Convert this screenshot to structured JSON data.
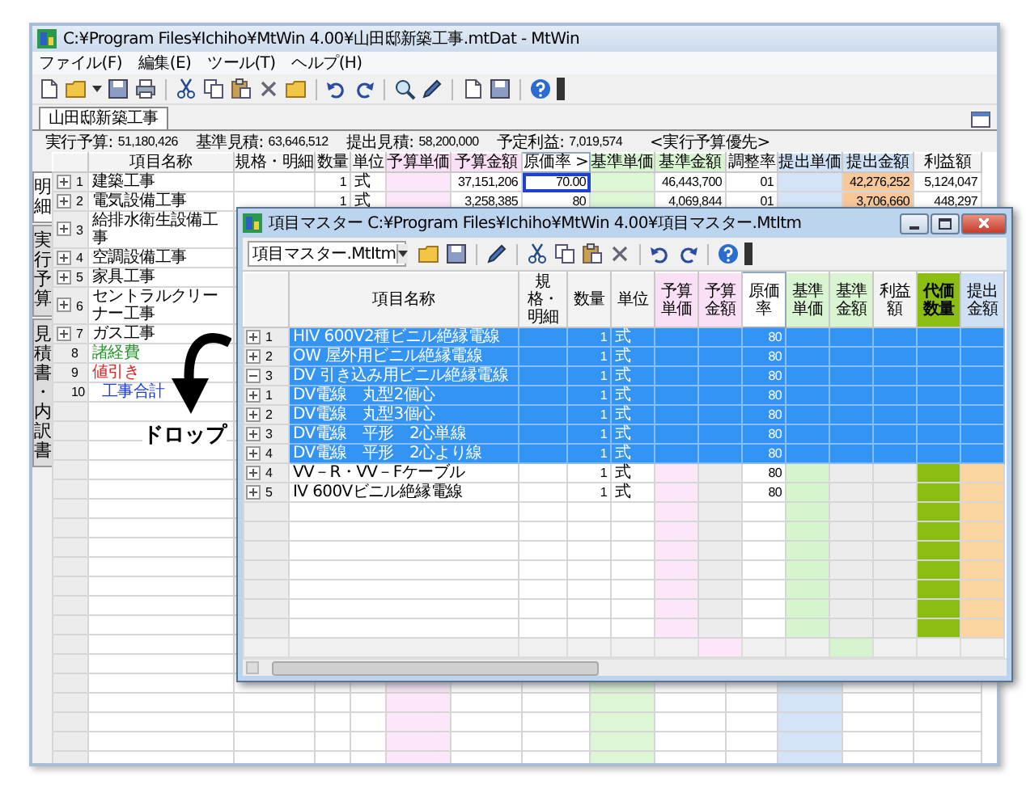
{
  "window": {
    "title": "C:¥Program Files¥Ichiho¥MtWin 4.00¥山田邸新築工事.mtDat - MtWin"
  },
  "menu": [
    "ファイル(F)",
    "編集(E)",
    "ツール(T)",
    "ヘルプ(H)"
  ],
  "tabs": [
    {
      "label": "山田邸新築工事",
      "selected": true
    }
  ],
  "summary": [
    {
      "label": "実行予算:",
      "value": "51,180,426"
    },
    {
      "label": "基準見積:",
      "value": "63,646,512"
    },
    {
      "label": "提出見積:",
      "value": "58,200,000"
    },
    {
      "label": "予定利益:",
      "value": "7,019,574"
    }
  ],
  "summary_note": "<実行予算優先>",
  "side_tabs": [
    {
      "label": "明細",
      "selected": true
    },
    {
      "label": "実行予算",
      "selected": false
    },
    {
      "label": "見積書・内訳書",
      "selected": false
    }
  ],
  "grid": {
    "columns": [
      {
        "label": "項目名称",
        "kind": "text"
      },
      {
        "label": "規格・明細",
        "kind": "text"
      },
      {
        "label": "数量",
        "kind": "qty"
      },
      {
        "label": "単位",
        "kind": "unit"
      },
      {
        "label": "予算単価",
        "kind": "budget-unit"
      },
      {
        "label": "予算金額",
        "kind": "budget-total"
      },
      {
        "label": "原価率 >",
        "kind": "rate"
      },
      {
        "label": "基準単価",
        "kind": "std-unit"
      },
      {
        "label": "基準金額",
        "kind": "std-total"
      },
      {
        "label": "調整率",
        "kind": "adjust"
      },
      {
        "label": "提出単価",
        "kind": "submit-unit"
      },
      {
        "label": "提出金額",
        "kind": "submit-total"
      },
      {
        "label": "利益額",
        "kind": "profit"
      }
    ],
    "rows": [
      {
        "no": "1",
        "name": "建築工事",
        "kind": "item",
        "expanded": false,
        "quantity": "1",
        "unit": "式",
        "budget_amount": "37,151,206",
        "cost_rate": "70.00",
        "editing": true,
        "std_amount": "46,443,700",
        "adjust": "01",
        "submit_amount": "42,276,252",
        "profit": "5,124,047"
      },
      {
        "no": "2",
        "name": "電気設備工事",
        "kind": "item",
        "expanded": false,
        "quantity": "1",
        "unit": "式",
        "budget_amount": "3,258,385",
        "cost_rate": "80",
        "std_amount": "4,069,844",
        "adjust": "01",
        "submit_amount": "3,706,660",
        "profit": "448,297"
      },
      {
        "no": "3",
        "name": "給排水衛生設備工事",
        "kind": "item",
        "expanded": false
      },
      {
        "no": "4",
        "name": "空調設備工事",
        "kind": "item",
        "expanded": false
      },
      {
        "no": "5",
        "name": "家具工事",
        "kind": "item",
        "expanded": false
      },
      {
        "no": "6",
        "name": "セントラルクリーナー工事",
        "kind": "item",
        "expanded": false
      },
      {
        "no": "7",
        "name": "ガス工事",
        "kind": "item",
        "expanded": false
      },
      {
        "no": "8",
        "name": "諸経費",
        "kind": "expense"
      },
      {
        "no": "9",
        "name": "値引き",
        "kind": "discount"
      },
      {
        "no": "10",
        "name": "工事合計",
        "kind": "total"
      }
    ]
  },
  "drop_label": "ドロップ",
  "item_master": {
    "title": "項目マスター C:¥Program Files¥Ichiho¥MtWin 4.00¥項目マスター.MtItm",
    "file": "項目マスター.MtItm",
    "columns": [
      {
        "label": "項目名称",
        "kind": "text"
      },
      {
        "label": "規格・明細",
        "kind": "text"
      },
      {
        "label": "数量",
        "kind": "qty"
      },
      {
        "label": "単位",
        "kind": "unit"
      },
      {
        "label": "予算単価",
        "kind": "budget-unit"
      },
      {
        "label": "予算金額",
        "kind": "budget-total"
      },
      {
        "label": "原価率",
        "kind": "rate"
      },
      {
        "label": "基準単価",
        "kind": "std-unit"
      },
      {
        "label": "基準金額",
        "kind": "std-total"
      },
      {
        "label": "利益額",
        "kind": "profit"
      },
      {
        "label": "代価数量",
        "kind": "cost-qty"
      },
      {
        "label": "提出金額",
        "kind": "submit-total"
      }
    ],
    "rows": [
      {
        "no": "1",
        "name": "HIV 600V2種ビニル絶縁電線",
        "quantity": "1",
        "unit": "式",
        "cost_rate": "80",
        "selected": true,
        "expanded": false
      },
      {
        "no": "2",
        "name": "OW 屋外用ビニル絶縁電線",
        "quantity": "1",
        "unit": "式",
        "cost_rate": "80",
        "selected": true,
        "expanded": false
      },
      {
        "no": "3",
        "name": "DV 引き込み用ビニル絶縁電線",
        "quantity": "1",
        "unit": "式",
        "cost_rate": "80",
        "selected": true,
        "expanded": true,
        "children": [
          {
            "no": "1",
            "name": "DV電線　丸型2個心",
            "quantity": "1",
            "unit": "式",
            "cost_rate": "80",
            "selected": true,
            "expanded": false
          },
          {
            "no": "2",
            "name": "DV電線　丸型3個心",
            "quantity": "1",
            "unit": "式",
            "cost_rate": "80",
            "selected": true,
            "expanded": false
          },
          {
            "no": "3",
            "name": "DV電線　平形　2心単線",
            "quantity": "1",
            "unit": "式",
            "cost_rate": "80",
            "selected": true,
            "expanded": false
          },
          {
            "no": "4",
            "name": "DV電線　平形　2心より線",
            "quantity": "1",
            "unit": "式",
            "cost_rate": "80",
            "selected": true,
            "expanded": false
          }
        ]
      },
      {
        "no": "4",
        "name": "VV－R・VV－Fケーブル",
        "quantity": "1",
        "unit": "式",
        "cost_rate": "80",
        "selected": false,
        "expanded": false
      },
      {
        "no": "5",
        "name": "IV 600Vビニル絶縁電線",
        "quantity": "1",
        "unit": "式",
        "cost_rate": "80",
        "selected": false,
        "expanded": false
      }
    ]
  }
}
